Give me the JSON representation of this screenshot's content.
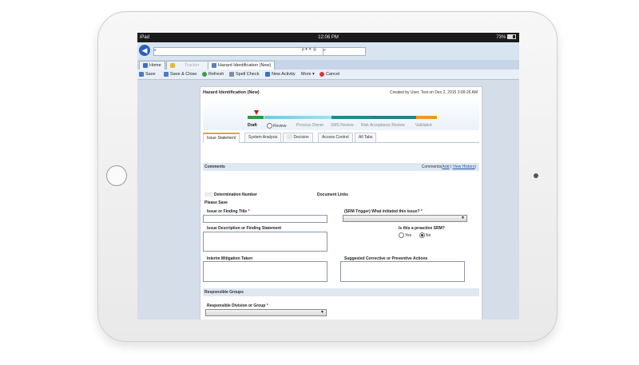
{
  "status_bar": {
    "device": "iPad",
    "time": "12:06 PM",
    "battery": "73%"
  },
  "browser": {
    "back_glyph": "◀",
    "url_prefix": "e",
    "url_tools": "ρ ▾ ✕ ◎",
    "tab_search_prefix": "e",
    "tabs": [
      {
        "label": "Home"
      },
      {
        "label": "Tracker"
      },
      {
        "label": "Hazard Identification (New)"
      }
    ]
  },
  "toolbar": {
    "save": "Save",
    "save_close": "Save & Close",
    "refresh": "Refresh",
    "spell_check": "Spell Check",
    "new_activity": "New Activity",
    "more": "More ▾",
    "cancel": "Cancel"
  },
  "form": {
    "title": "Hazard Identification (New)",
    "created": "Created by User, Test on Dec 2, 2015 3:00:26 AM",
    "stages": [
      "Draft",
      "Review",
      "Process Owner",
      "SMS Review",
      "Risk Acceptance Review",
      "Validated"
    ],
    "current_stage": "Draft",
    "tabs": [
      "Issue Statement",
      "System Analysis",
      "Decision",
      "Access Control",
      "All Tabs"
    ],
    "comments": {
      "header": "Comments",
      "right_label": "Comments(",
      "add_link": "Add",
      "separator": "|",
      "view_link": "View History",
      "close": ")"
    },
    "determination_label": "Determination Number",
    "document_links_label": "Document Links",
    "please_save": "Please Save",
    "issue_title_label": "Issue or Finding Title",
    "srm_trigger_label": "(SRM Trigger) What initiated this issue?",
    "issue_desc_label": "Issue Description or Finding Statement",
    "proactive_label": "Is this a proactive SRM?",
    "yes": "Yes",
    "no": "No",
    "proactive_value": "No",
    "interim_label": "Interim Mitigation Taken",
    "suggested_label": "Suggested Corrective or Preventive Actions",
    "responsible_groups": "Responsible Groups",
    "responsible_division_label": "Responsible Division or Group",
    "required_mark": "*"
  },
  "colors": {
    "stage_draft": "#2e9a3a",
    "stage_review": "#78c6e6",
    "stage_process": "#a9dcef",
    "stage_sms": "#1f8a8a",
    "stage_risk": "#2a7d8c",
    "stage_validated": "#f09a1a"
  }
}
